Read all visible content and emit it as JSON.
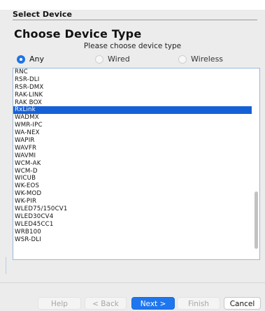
{
  "dialog": {
    "title": "Select Device",
    "heading": "Choose Device Type",
    "instruction": "Please choose device type"
  },
  "filter": {
    "options": [
      "Any",
      "Wired",
      "Wireless"
    ],
    "selected": "Any"
  },
  "device_list": {
    "items": [
      "RNC",
      "RSR-DLI",
      "RSR-DMX",
      "RAK-LINK",
      "RAK BOX",
      "RxLink",
      "WADMX",
      "WMR-IPC",
      "WA-NEX",
      "WAPIR",
      "WAVFR",
      "WAVMI",
      "WCM-AK",
      "WCM-D",
      "WICUB",
      "WK-EOS",
      "WK-MOD",
      "WK-PIR",
      "WLED75/150CV1",
      "WLED30CV4",
      "WLED45CC1",
      "WRB100",
      "WSR-DLI"
    ],
    "selected": "RxLink"
  },
  "buttons": {
    "help": "Help",
    "back": "< Back",
    "next": "Next >",
    "finish": "Finish",
    "cancel": "Cancel"
  },
  "colors": {
    "accent": "#1f77ef",
    "selection": "#1560d6"
  }
}
